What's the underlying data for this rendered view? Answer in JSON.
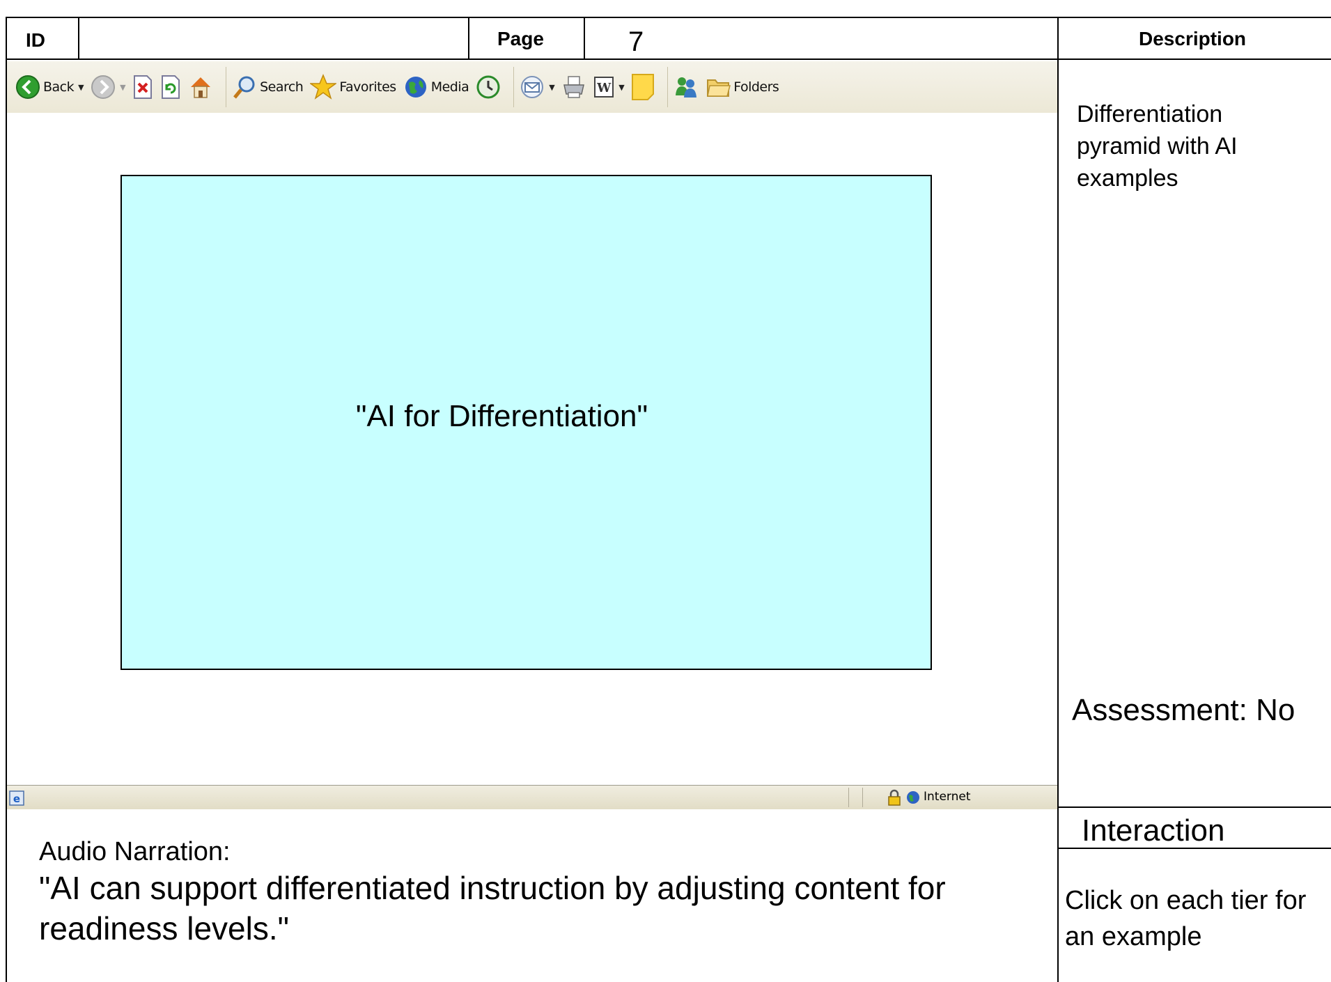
{
  "header": {
    "id_label": "ID",
    "id_value": "",
    "page_label": "Page",
    "page_value": "7",
    "description_label": "Description"
  },
  "toolbar": {
    "back_label": "Back",
    "search_label": "Search",
    "favorites_label": "Favorites",
    "media_label": "Media",
    "folders_label": "Folders"
  },
  "stage": {
    "title": "\"AI for Differentiation\"",
    "background": "#c8ffff"
  },
  "statusbar": {
    "zone_label": "Internet"
  },
  "description": {
    "text": "Differentiation pyramid with AI examples",
    "assessment": "Assessment: No"
  },
  "narration": {
    "label": "Audio Narration:",
    "text": "\"AI can support differentiated instruction by adjusting content for readiness levels.\""
  },
  "interaction": {
    "title": "Interaction",
    "text": "Click on each tier for an example"
  },
  "colors": {
    "stage_fill": "#c8ffff",
    "toolbar_bg": "#ece8d6"
  }
}
